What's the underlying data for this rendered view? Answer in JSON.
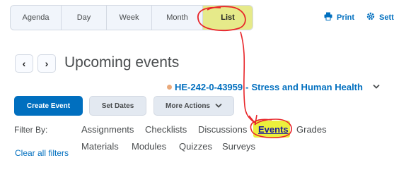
{
  "tabs": [
    {
      "label": "Agenda"
    },
    {
      "label": "Day"
    },
    {
      "label": "Week"
    },
    {
      "label": "Month"
    },
    {
      "label": "List",
      "active": true
    }
  ],
  "toolbar": {
    "print_label": "Print",
    "settings_label": "Setti"
  },
  "header": {
    "title": "Upcoming events",
    "prev_label": "‹",
    "next_label": "›"
  },
  "course": {
    "code": "HE-242-0-43959",
    "sep": " - ",
    "name": "Stress and Human Health"
  },
  "actions": {
    "create": "Create Event",
    "set_dates": "Set Dates",
    "more": "More Actions"
  },
  "filters": {
    "label": "Filter By:",
    "clear": "Clear all filters",
    "row1": [
      "Assignments",
      "Checklists",
      "Discussions",
      "Events",
      "Grades"
    ],
    "row2": [
      "Materials",
      "Modules",
      "Quizzes",
      "Surveys"
    ]
  },
  "colors": {
    "accent": "#006fbf",
    "highlight": "#ecef3c",
    "annotation": "#e8262a"
  },
  "icons": [
    "printer-icon",
    "gear-icon",
    "chevron-down-icon",
    "chevron-left-icon",
    "chevron-right-icon"
  ]
}
